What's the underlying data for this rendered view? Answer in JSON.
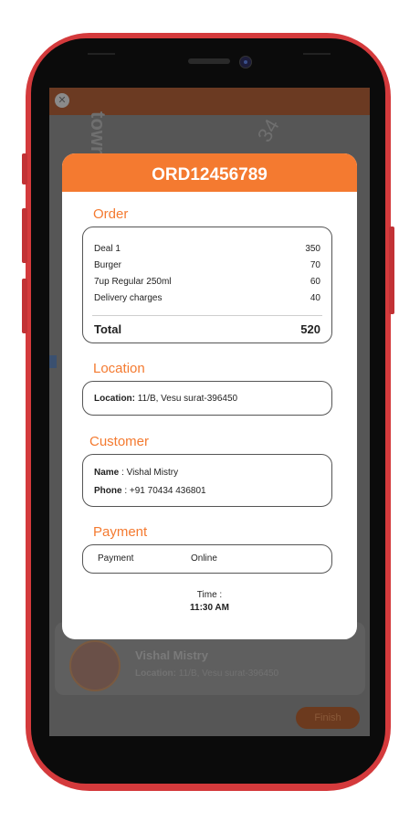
{
  "background_app": {
    "map_text_1": "town",
    "map_text_2": "34",
    "customer_name": "Vishal Mistry",
    "location_label": "Location:",
    "location_value": "11/B, Vesu surat-396450",
    "finish_label": "Finish"
  },
  "modal": {
    "order_id": "ORD12456789",
    "order": {
      "title": "Order",
      "items": [
        {
          "name": "Deal 1",
          "price": "350"
        },
        {
          "name": "Burger",
          "price": "70"
        },
        {
          "name": "7up Regular 250ml",
          "price": "60"
        },
        {
          "name": "Delivery charges",
          "price": "40"
        }
      ],
      "total_label": "Total",
      "total_value": "520"
    },
    "location": {
      "title": "Location",
      "label": "Location:",
      "value": "11/B, Vesu surat-396450"
    },
    "customer": {
      "title": "Customer",
      "name_label": "Name",
      "name_value": ": Vishal Mistry",
      "phone_label": "Phone",
      "phone_value": ": +91 70434 436801"
    },
    "payment": {
      "title": "Payment",
      "label": "Payment",
      "value": "Online"
    },
    "time_label": "Time :",
    "time_value": "11:30 AM"
  },
  "colors": {
    "accent": "#f47a30",
    "phone_frame": "#d43a3c"
  }
}
